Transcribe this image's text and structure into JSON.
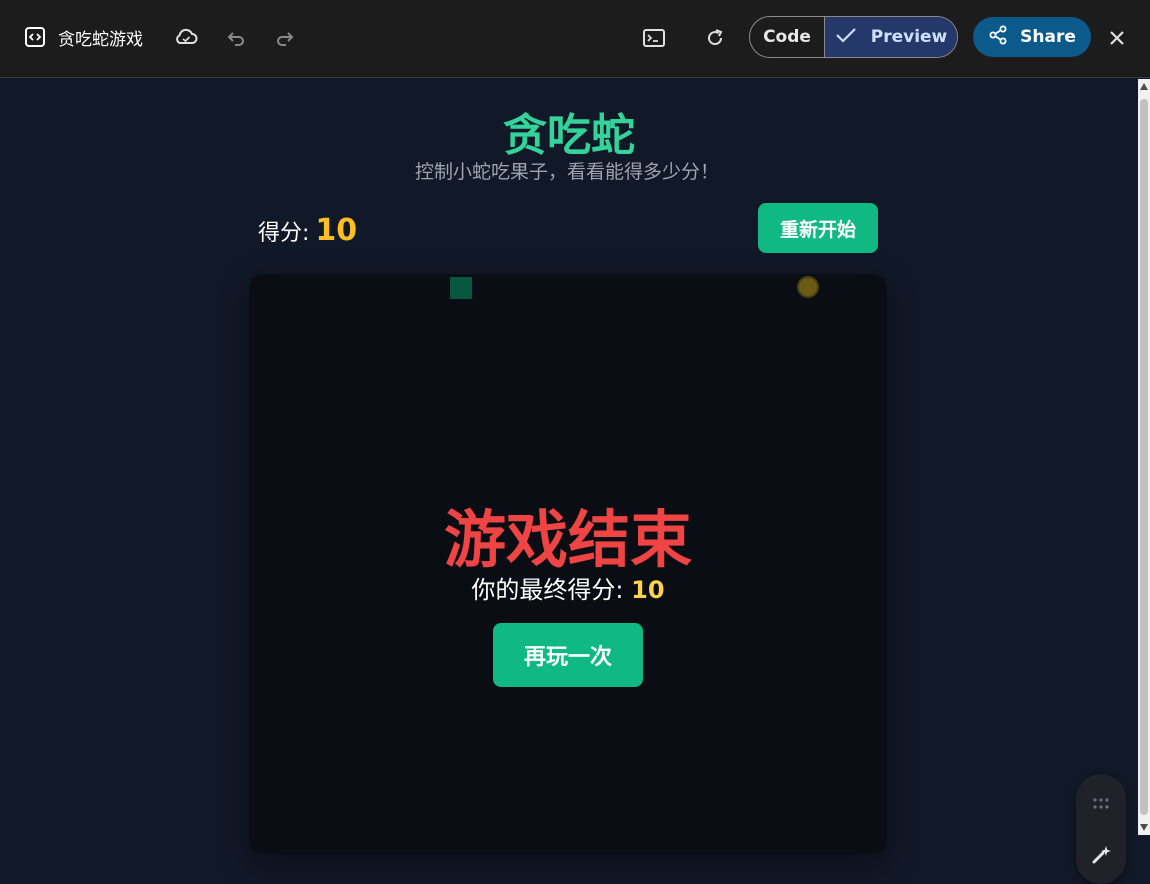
{
  "window": {
    "app_title": "贪吃蛇游戏",
    "code_label": "Code",
    "preview_label": "Preview",
    "share_label": "Share"
  },
  "game": {
    "title": "贪吃蛇",
    "subtitle": "控制小蛇吃果子，看看能得多少分！",
    "score_label": "得分:",
    "score": "10",
    "restart_label": "重新开始",
    "game_over_title": "游戏结束",
    "final_score_label": "你的最终得分:",
    "final_score": "10",
    "play_again_label": "再玩一次"
  },
  "colors": {
    "accent_green": "#10b981",
    "title_green": "#34d399",
    "score_yellow": "#fbbf24",
    "game_over_red": "#ef4444",
    "preview_active": "#24386a",
    "share_blue": "#0c5a8c"
  },
  "icons": {
    "app": "code-window-icon",
    "cloud": "cloud-icon",
    "undo": "undo-icon",
    "redo": "redo-icon",
    "terminal": "terminal-icon",
    "reload": "refresh-icon",
    "check": "check-icon",
    "share": "share-icon",
    "close": "close-icon",
    "grip": "drag-handle-icon",
    "spark": "sparkle-icon"
  }
}
